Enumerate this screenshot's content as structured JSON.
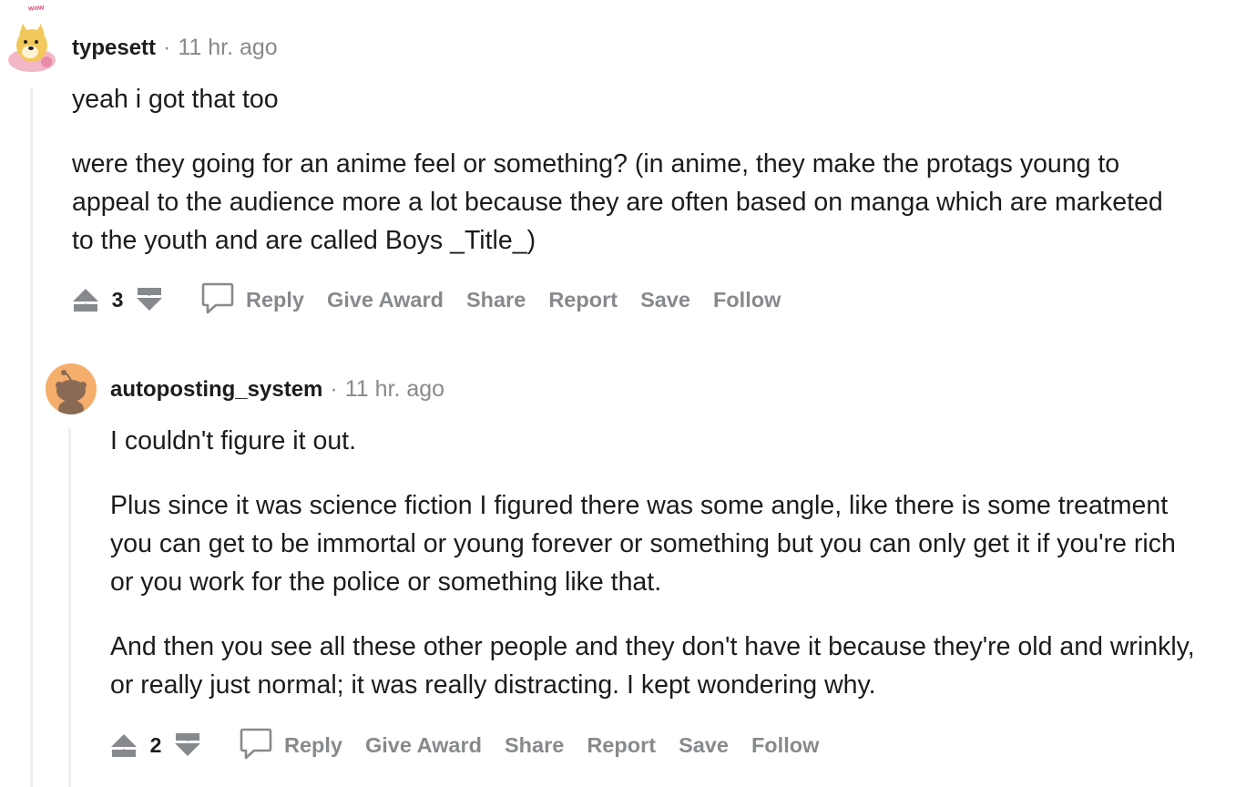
{
  "comments": [
    {
      "author": "typesett",
      "separator": "·",
      "time": "11 hr. ago",
      "avatar_icon": "doge-avatar-icon",
      "avatar_badge": "wow",
      "paragraphs": [
        "yeah i got that too",
        "were they going for an anime feel or something? (in anime, they make the protags young to appeal to the audience more a lot because they are often based on manga which are marketed to the youth and are called Boys _Title_)"
      ],
      "score": "3",
      "actions": {
        "reply": "Reply",
        "award": "Give Award",
        "share": "Share",
        "report": "Report",
        "save": "Save",
        "follow": "Follow"
      }
    },
    {
      "author": "autoposting_system",
      "separator": "·",
      "time": "11 hr. ago",
      "avatar_icon": "snoo-avatar-icon",
      "paragraphs": [
        "I couldn't figure it out.",
        "Plus since it was science fiction I figured there was some angle, like there is some treatment you can get to be immortal or young forever or something but you can only get it if you're rich or you work for the police or something like that.",
        "And then you see all these other people and they don't have it because they're old and wrinkly, or really just normal; it was really distracting. I kept wondering why."
      ],
      "score": "2",
      "actions": {
        "reply": "Reply",
        "award": "Give Award",
        "share": "Share",
        "report": "Report",
        "save": "Save",
        "follow": "Follow"
      }
    }
  ],
  "colors": {
    "meta_gray": "#878a8c",
    "thread_line": "#edeff1",
    "text": "#1c1c1c",
    "snoo_bg": "#f6ae6c"
  }
}
